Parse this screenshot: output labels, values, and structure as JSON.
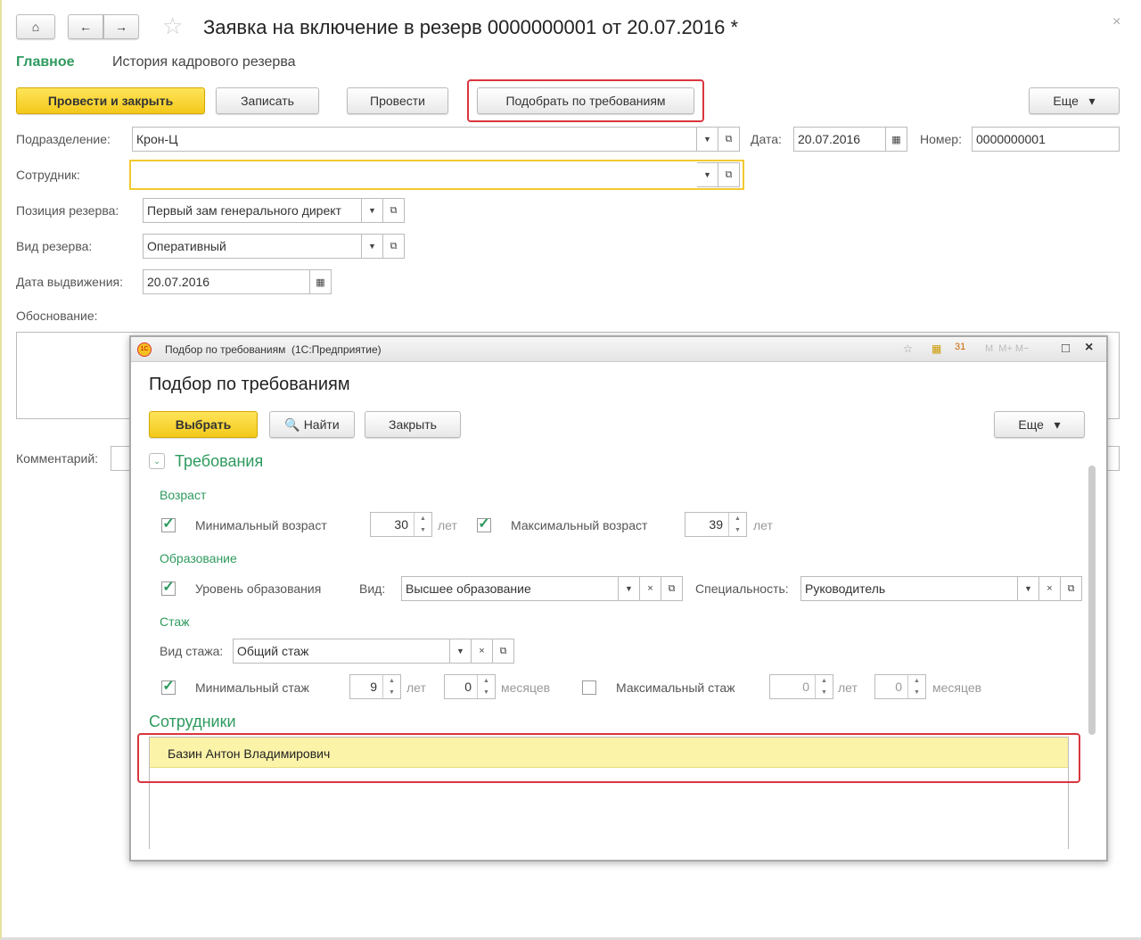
{
  "header": {
    "title": "Заявка на включение в резерв 0000000001 от 20.07.2016 *",
    "tabs": [
      "Главное",
      "История кадрового резерва"
    ]
  },
  "toolbar": {
    "post_close": "Провести и закрыть",
    "save": "Записать",
    "post": "Провести",
    "select_by_req": "Подобрать по требованиям",
    "more": "Еще"
  },
  "form": {
    "division_label": "Подразделение:",
    "division": "Крон-Ц",
    "date_label": "Дата:",
    "date": "20.07.2016",
    "number_label": "Номер:",
    "number": "0000000001",
    "employee_label": "Сотрудник:",
    "employee": "",
    "position_label": "Позиция резерва:",
    "position": "Первый зам генерального директ",
    "type_label": "Вид резерва:",
    "type": "Оперативный",
    "nom_date_label": "Дата выдвижения:",
    "nom_date": "20.07.2016",
    "reason_label": "Обоснование:",
    "comment_label": "Комментарий:"
  },
  "dialog": {
    "window_title": "Подбор по требованиям  (1С:Предприятие)",
    "title": "Подбор по требованиям",
    "select": "Выбрать",
    "find": "Найти",
    "close": "Закрыть",
    "more": "Еще",
    "requirements": "Требования",
    "age": "Возраст",
    "min_age_label": "Минимальный возраст",
    "min_age": "30",
    "max_age_label": "Максимальный возраст",
    "max_age": "39",
    "years": "лет",
    "education": "Образование",
    "edu_level_label": "Уровень образования",
    "kind_label": "Вид:",
    "kind": "Высшее образование",
    "spec_label": "Специальность:",
    "spec": "Руководитель",
    "experience": "Стаж",
    "exp_type_label": "Вид стажа:",
    "exp_type": "Общий стаж",
    "min_exp_label": "Минимальный стаж",
    "min_exp_years": "9",
    "min_exp_months": "0",
    "months": "месяцев",
    "max_exp_label": "Максимальный стаж",
    "max_exp_years": "0",
    "max_exp_months": "0",
    "employees": "Сотрудники",
    "employee_rows": [
      "Базин Антон Владимирович"
    ]
  }
}
